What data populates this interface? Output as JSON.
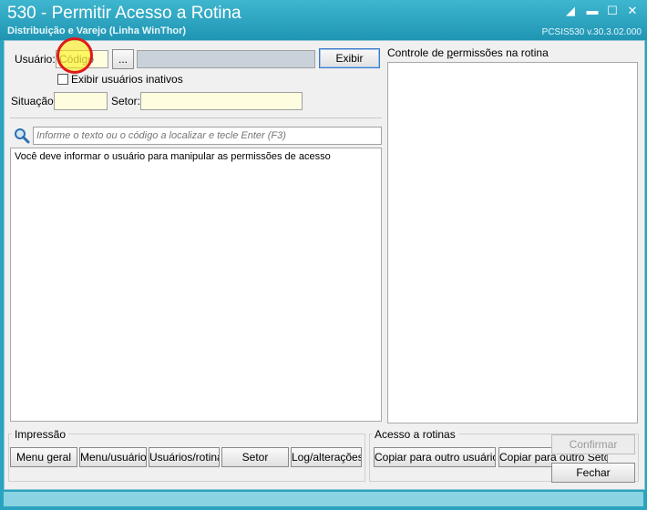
{
  "window": {
    "title": "530 - Permitir Acesso a Rotina",
    "subtitle": "Distribuição e Varejo (Linha WinThor)",
    "version": "PCSIS530  v.30.3.02.000",
    "controls": [
      "minimize-icon",
      "restore-icon",
      "maximize-icon",
      "close-icon"
    ]
  },
  "user": {
    "label": "Usuário:",
    "code_placeholder": "Código",
    "browse_label": "...",
    "name_value": "",
    "show_button": "Exibir",
    "inactive_checkbox_label": "Exibir usuários inativos",
    "inactive_checked": false
  },
  "filters": {
    "situation_label": "Situação:",
    "situation_value": "",
    "sector_label": "Setor:",
    "sector_value": ""
  },
  "search": {
    "icon": "search-icon",
    "placeholder": "Informe o texto ou o código a localizar e tecle Enter (F3)"
  },
  "list": {
    "message": "Você deve informar o usuário para manipular as permissões de acesso"
  },
  "permissions": {
    "title": "Controle de permissões na rotina"
  },
  "print": {
    "title": "Impressão",
    "buttons": [
      "Menu geral",
      "Menu/usuário",
      "Usuários/rotina",
      "Setor",
      "Log/alterações"
    ]
  },
  "access": {
    "title": "Acesso a rotinas",
    "copy_user": "Copiar para outro usuário",
    "copy_sector": "Copiar para outro Setor"
  },
  "actions": {
    "confirm": "Confirmar",
    "close": "Fechar"
  },
  "colors": {
    "titlebar": "#2aa3bf",
    "input_bg": "#fffde0",
    "highlight_ring": "#e01919"
  }
}
